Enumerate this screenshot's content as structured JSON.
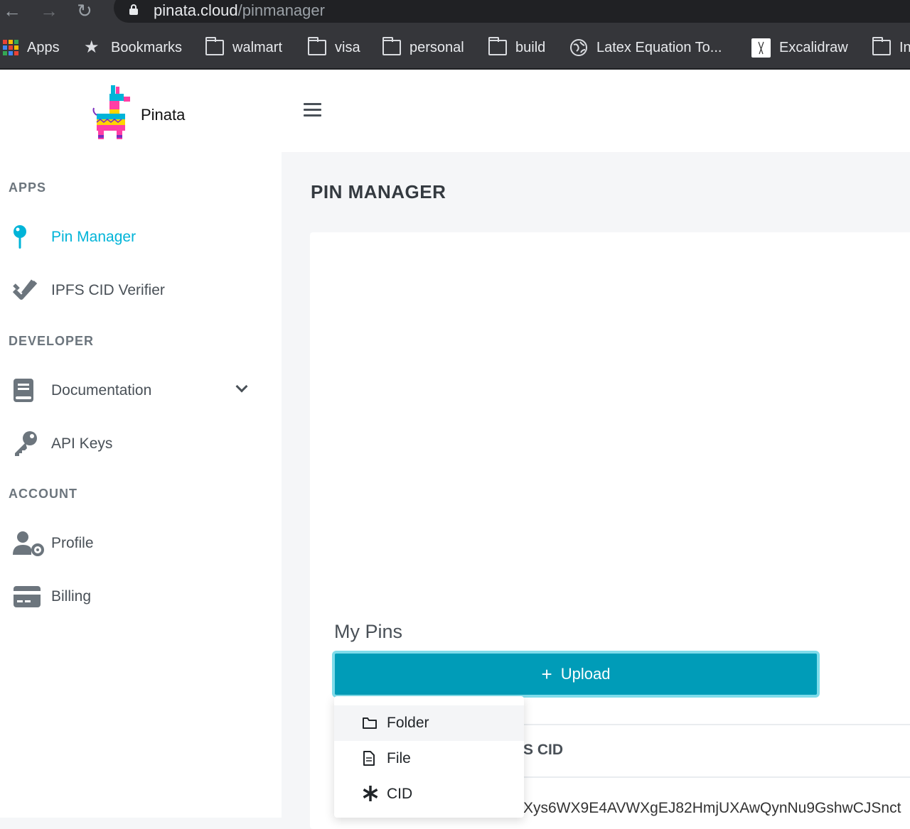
{
  "browser": {
    "url_domain": "pinata.cloud",
    "url_path": "/pinmanager",
    "bookmarks": [
      {
        "label": "Apps",
        "icon": "apps-grid-icon"
      },
      {
        "label": "Bookmarks",
        "icon": "star-icon"
      },
      {
        "label": "walmart",
        "icon": "folder-icon"
      },
      {
        "label": "visa",
        "icon": "folder-icon"
      },
      {
        "label": "personal",
        "icon": "folder-icon"
      },
      {
        "label": "build",
        "icon": "folder-icon"
      },
      {
        "label": "Latex Equation To...",
        "icon": "globe-icon"
      },
      {
        "label": "Excalidraw",
        "icon": "excalidraw-icon"
      },
      {
        "label": "In",
        "icon": "folder-icon"
      }
    ]
  },
  "header": {
    "brand": "Pinata"
  },
  "sidebar": {
    "sections": [
      {
        "title": "APPS"
      },
      {
        "title": "DEVELOPER"
      },
      {
        "title": "ACCOUNT"
      }
    ],
    "items": [
      {
        "label": "Pin Manager",
        "icon": "pin-icon",
        "active": true
      },
      {
        "label": "IPFS CID Verifier",
        "icon": "double-check-icon"
      },
      {
        "label": "Documentation",
        "icon": "book-icon"
      },
      {
        "label": "API Keys",
        "icon": "key-icon"
      },
      {
        "label": "Profile",
        "icon": "user-gear-icon"
      },
      {
        "label": "Billing",
        "icon": "credit-card-icon"
      }
    ]
  },
  "main": {
    "page_title": "PIN MANAGER",
    "my_pins_title": "My Pins",
    "upload_label": "Upload",
    "table_column_visible": "S CID",
    "table_cell_cid": "Xys6WX9E4AVWXgEJ82HmjUXAwQynNu9GshwCJSnct"
  },
  "upload_menu": {
    "items": [
      {
        "label": "Folder",
        "icon": "folder-outline-icon"
      },
      {
        "label": "File",
        "icon": "file-icon"
      },
      {
        "label": "CID",
        "icon": "asterisk-icon"
      }
    ]
  },
  "colors": {
    "accent": "#00b4d8",
    "upload_button": "#009cb8",
    "chrome_dark": "#35363a"
  }
}
